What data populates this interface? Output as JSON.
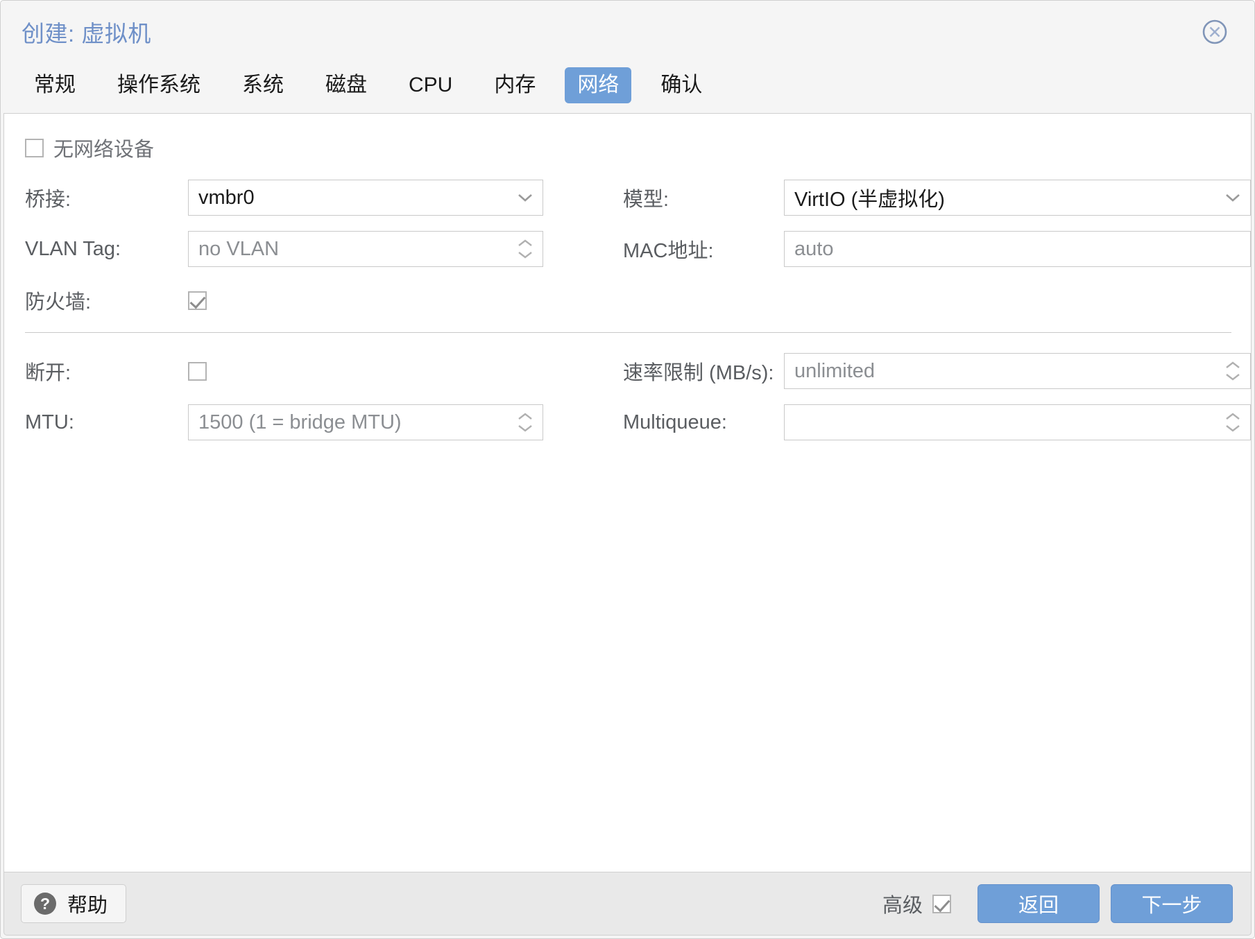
{
  "dialog": {
    "title": "创建: 虚拟机",
    "close_icon": "close-circle-icon"
  },
  "tabs": [
    {
      "label": "常规",
      "active": false
    },
    {
      "label": "操作系统",
      "active": false
    },
    {
      "label": "系统",
      "active": false
    },
    {
      "label": "磁盘",
      "active": false
    },
    {
      "label": "CPU",
      "active": false
    },
    {
      "label": "内存",
      "active": false
    },
    {
      "label": "网络",
      "active": true
    },
    {
      "label": "确认",
      "active": false
    }
  ],
  "form": {
    "no_network_device": {
      "label": "无网络设备",
      "checked": false
    },
    "bridge": {
      "label": "桥接:",
      "value": "vmbr0",
      "is_placeholder": false,
      "control": "combobox"
    },
    "model": {
      "label": "模型:",
      "value": "VirtIO (半虚拟化)",
      "is_placeholder": false,
      "control": "combobox"
    },
    "vlan_tag": {
      "label": "VLAN Tag:",
      "value": "no VLAN",
      "is_placeholder": true,
      "control": "spinner"
    },
    "mac_address": {
      "label": "MAC地址:",
      "value": "auto",
      "is_placeholder": true,
      "control": "text"
    },
    "firewall": {
      "label": "防火墙:",
      "checked": true
    },
    "disconnect": {
      "label": "断开:",
      "checked": false
    },
    "rate_limit": {
      "label": "速率限制 (MB/s):",
      "value": "unlimited",
      "is_placeholder": true,
      "control": "spinner"
    },
    "mtu": {
      "label": "MTU:",
      "value": "1500 (1 = bridge MTU)",
      "is_placeholder": true,
      "control": "spinner"
    },
    "multiqueue": {
      "label": "Multiqueue:",
      "value": "",
      "is_placeholder": true,
      "control": "spinner"
    }
  },
  "footer": {
    "help_label": "帮助",
    "help_icon": "question-mark-icon",
    "advanced_label": "高级",
    "advanced_checked": true,
    "back_label": "返回",
    "next_label": "下一步"
  },
  "colors": {
    "accent_blue": "#6f9fd8",
    "title_blue": "#6f90c8",
    "header_bg": "#f5f5f5",
    "footer_bg": "#e9e9e9",
    "field_border": "#c9c9c9",
    "label_text": "#5a5d61"
  }
}
